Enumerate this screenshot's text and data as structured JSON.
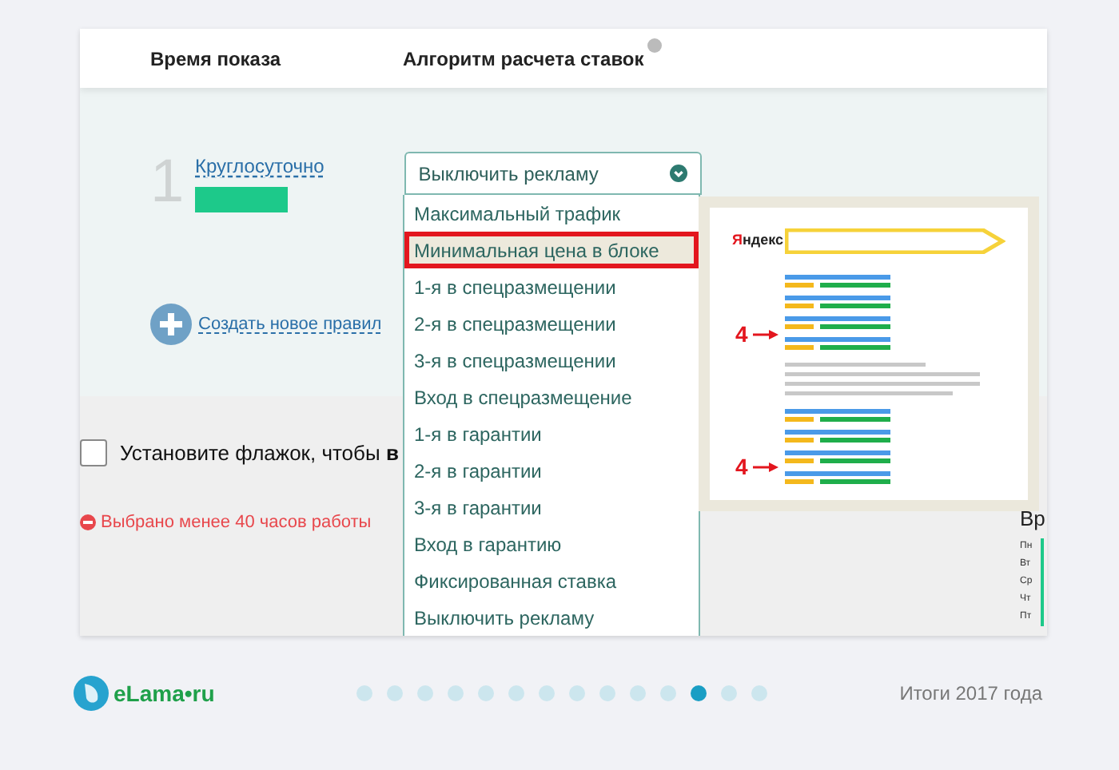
{
  "header": {
    "columns": [
      {
        "label": "Время показа",
        "help": false
      },
      {
        "label": "Алгоритм расчета ставок",
        "help": true
      }
    ]
  },
  "rule": {
    "number": "1",
    "time_link": "Круглосуточно",
    "color": "#1dc98a"
  },
  "create_rule_link": "Создать новое правил",
  "select": {
    "value": "Выключить рекламу",
    "expanded": true
  },
  "options": [
    {
      "label": "Максимальный трафик",
      "highlighted": false
    },
    {
      "label": "Минимальная цена в блоке",
      "highlighted": true
    },
    {
      "label": "1-я в спецразмещении",
      "highlighted": false
    },
    {
      "label": "2-я в спецразмещении",
      "highlighted": false
    },
    {
      "label": "3-я в спецразмещении",
      "highlighted": false
    },
    {
      "label": "Вход в спецразмещение",
      "highlighted": false
    },
    {
      "label": "1-я в гарантии",
      "highlighted": false
    },
    {
      "label": "2-я в гарантии",
      "highlighted": false
    },
    {
      "label": "3-я в гарантии",
      "highlighted": false
    },
    {
      "label": "Вход в гарантию",
      "highlighted": false
    },
    {
      "label": "Фиксированная ставка",
      "highlighted": false
    },
    {
      "label": "Выключить рекламу",
      "highlighted": false
    }
  ],
  "preview": {
    "brand": "Яндекс",
    "markers": [
      "4",
      "4"
    ]
  },
  "checkbox": {
    "label": "Установите флажок, чтобы **в**",
    "checked": false
  },
  "error": "Выбрано менее 40 часов работы",
  "side_panel": {
    "title": "Вр",
    "days": [
      "Пн",
      "Вт",
      "Ср",
      "Чт",
      "Пт"
    ]
  },
  "footer": {
    "logo": "eLama•ru",
    "pager": [
      {
        "selected": false
      },
      {
        "selected": false
      },
      {
        "selected": false
      },
      {
        "selected": false
      },
      {
        "selected": false
      },
      {
        "selected": false
      },
      {
        "selected": false
      },
      {
        "selected": false
      },
      {
        "selected": false
      },
      {
        "selected": false
      },
      {
        "selected": false
      },
      {
        "selected": true
      },
      {
        "selected": false
      },
      {
        "selected": false
      }
    ],
    "caption": "Итоги 2017 года"
  }
}
